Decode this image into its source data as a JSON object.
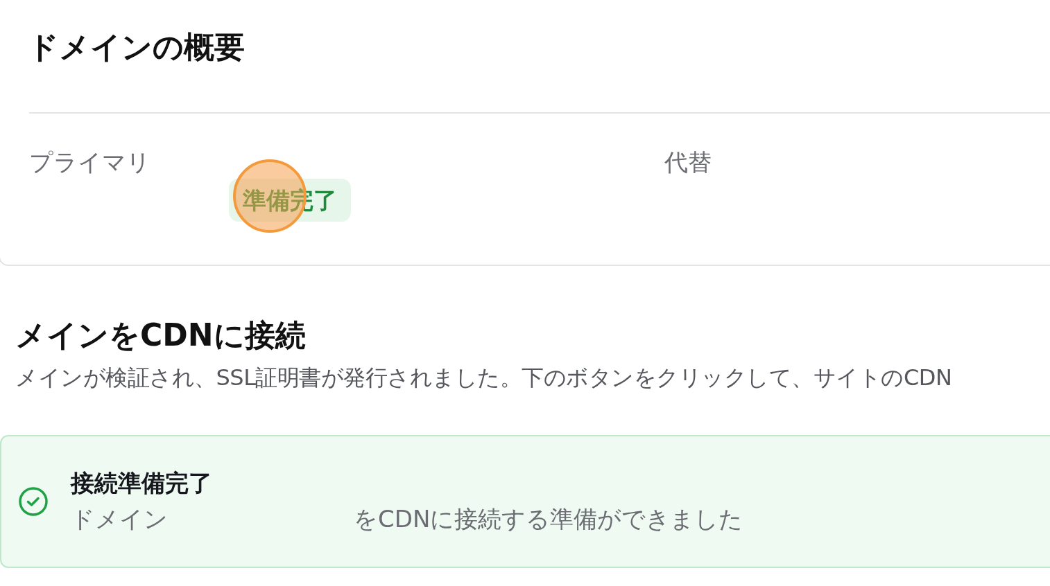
{
  "overview": {
    "title": "ドメインの概要",
    "primary": {
      "label": "プライマリ",
      "badge": {
        "text": "準備完了"
      }
    },
    "alternate": {
      "label": "代替"
    }
  },
  "click_indicator": {
    "visible": true
  },
  "connect": {
    "title": "メインをCDNに接続",
    "description": "メインが検証され、SSL証明書が発行されました。下のボタンをクリックして、サイトのCDN"
  },
  "alert": {
    "kind": "success",
    "title": "接続準備完了",
    "message_start": "ドメイン",
    "message_end": "をCDNに接続する準備ができました"
  }
}
